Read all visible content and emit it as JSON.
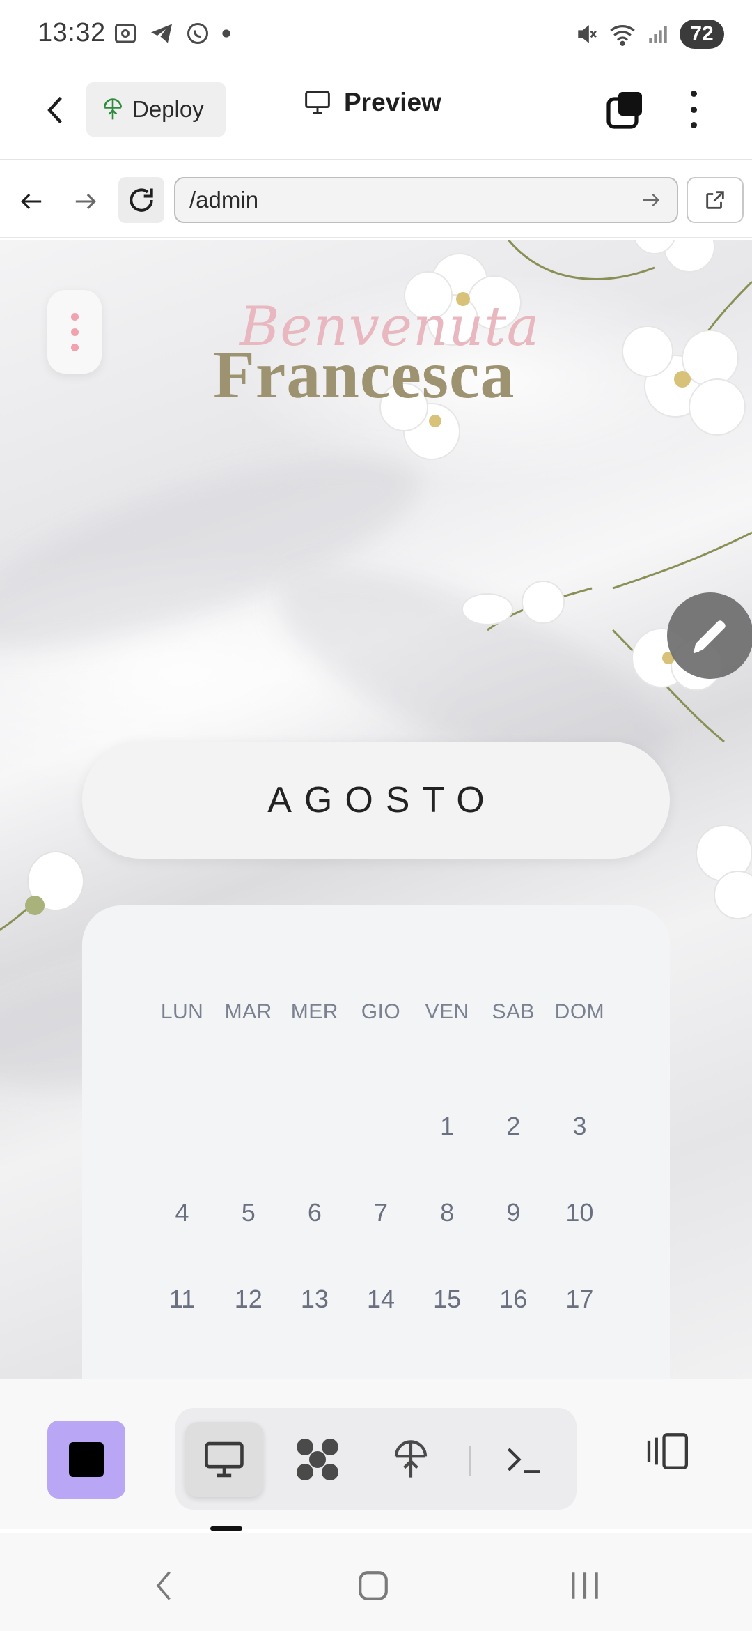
{
  "status_bar": {
    "time": "13:32",
    "left_icons": [
      "screenshot-icon",
      "telegram-icon",
      "whatsapp-icon",
      "dot-icon"
    ],
    "right_icons": [
      "mute-icon",
      "wifi-icon",
      "signal-icon"
    ],
    "battery": "72"
  },
  "header": {
    "deploy_label": "Deploy",
    "title": "Preview"
  },
  "url_bar": {
    "value": "/admin"
  },
  "page": {
    "greeting_sub": "Benvenuta",
    "greeting_name": "Francesca",
    "month": "AGOSTO",
    "weekdays": [
      "LUN",
      "MAR",
      "MER",
      "GIO",
      "VEN",
      "SAB",
      "DOM"
    ],
    "days": [
      [
        "",
        "",
        "",
        "",
        "1",
        "2",
        "3"
      ],
      [
        "4",
        "5",
        "6",
        "7",
        "8",
        "9",
        "10"
      ],
      [
        "11",
        "12",
        "13",
        "14",
        "15",
        "16",
        "17"
      ]
    ]
  },
  "colors": {
    "accent_purple": "#b9a7f5",
    "greeting_pink": "#e8b7bf",
    "greeting_olive": "#9d9370",
    "menu_dots": "#f0a3ae"
  },
  "toolbar": {
    "tools": [
      "monitor-icon",
      "puzzle-icon",
      "deploy-icon",
      "terminal-icon"
    ]
  }
}
